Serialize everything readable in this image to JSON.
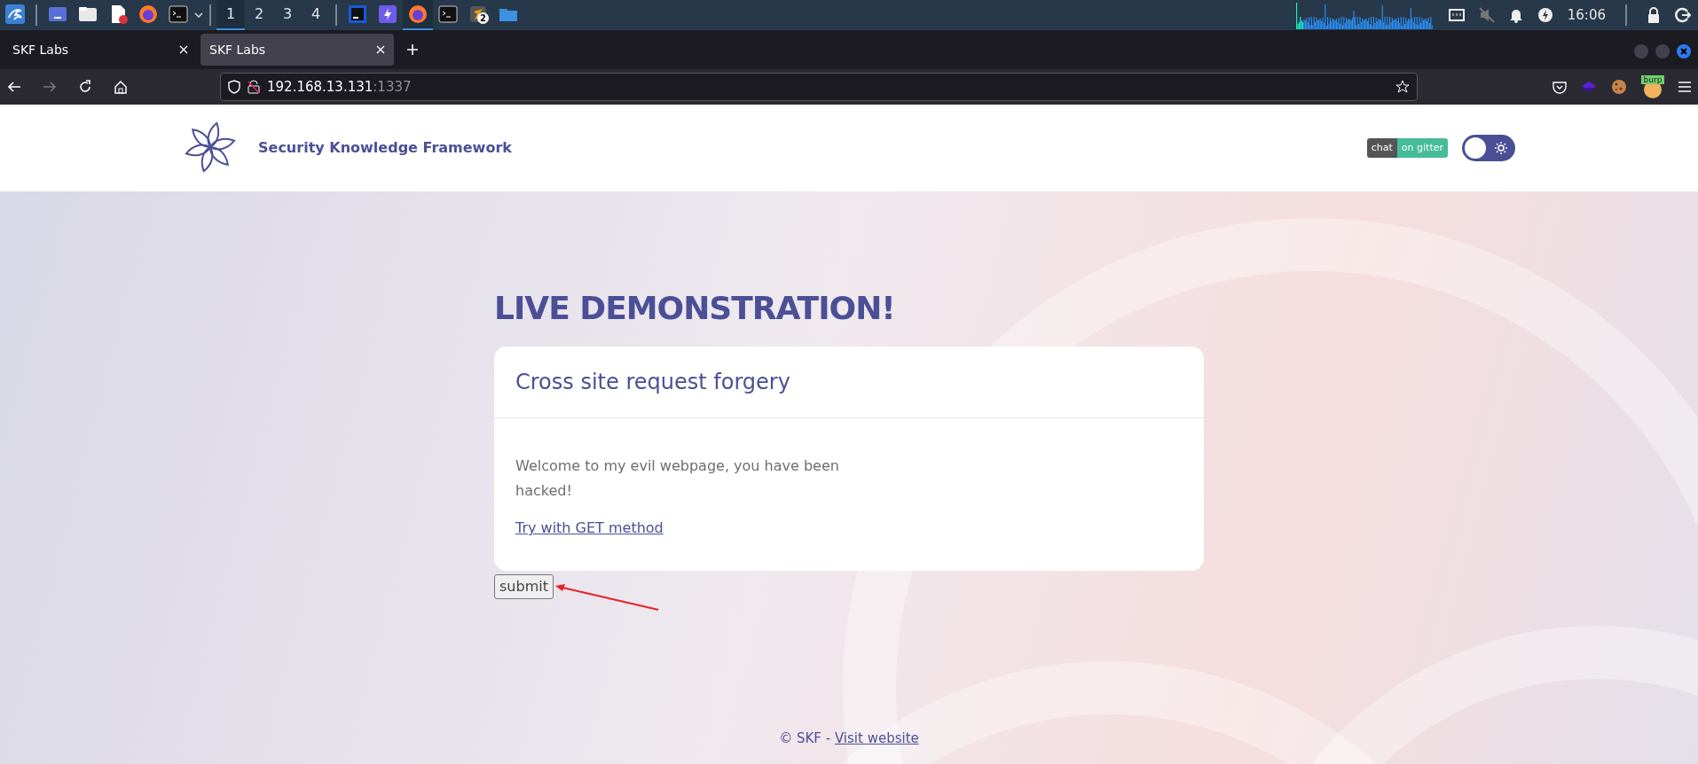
{
  "taskbar": {
    "apps": [
      {
        "kind": "menu",
        "active": false
      },
      {
        "kind": "desktop",
        "active": false
      },
      {
        "kind": "files",
        "active": false
      },
      {
        "kind": "editor",
        "active": false
      },
      {
        "kind": "firefox",
        "active": false
      },
      {
        "kind": "terminal",
        "active": false
      }
    ],
    "workspaces": [
      {
        "label": "1",
        "selected": true
      },
      {
        "label": "2",
        "selected": false
      },
      {
        "label": "3",
        "selected": false
      },
      {
        "label": "4",
        "selected": false
      }
    ],
    "windows": [
      {
        "kind": "ide",
        "active": false
      },
      {
        "kind": "bolt",
        "active": false
      },
      {
        "kind": "firefox",
        "active": true
      },
      {
        "kind": "terminal",
        "active": false
      },
      {
        "kind": "burp",
        "active": false,
        "badge": "2"
      },
      {
        "kind": "folder",
        "active": false
      }
    ],
    "clock": "16:06"
  },
  "browser": {
    "tabs": [
      {
        "title": "SKF Labs",
        "selected": false
      },
      {
        "title": "SKF Labs",
        "selected": true
      }
    ],
    "address": {
      "host": "192.168.13.131",
      "port": ":1337"
    },
    "extension_label": "burp"
  },
  "page": {
    "brand": "Security Knowledge Framework",
    "chat_badge": {
      "left": "chat",
      "right": "on gitter"
    },
    "theme_toggle": {
      "dark": false
    },
    "heading": "LIVE DEMONSTRATION!",
    "card": {
      "title": "Cross site request forgery",
      "text": "Welcome to my evil webpage, you have been hacked!",
      "link": "Try with GET method"
    },
    "button": "submit",
    "footer": {
      "text": "© SKF -",
      "link": "Visit website"
    }
  }
}
